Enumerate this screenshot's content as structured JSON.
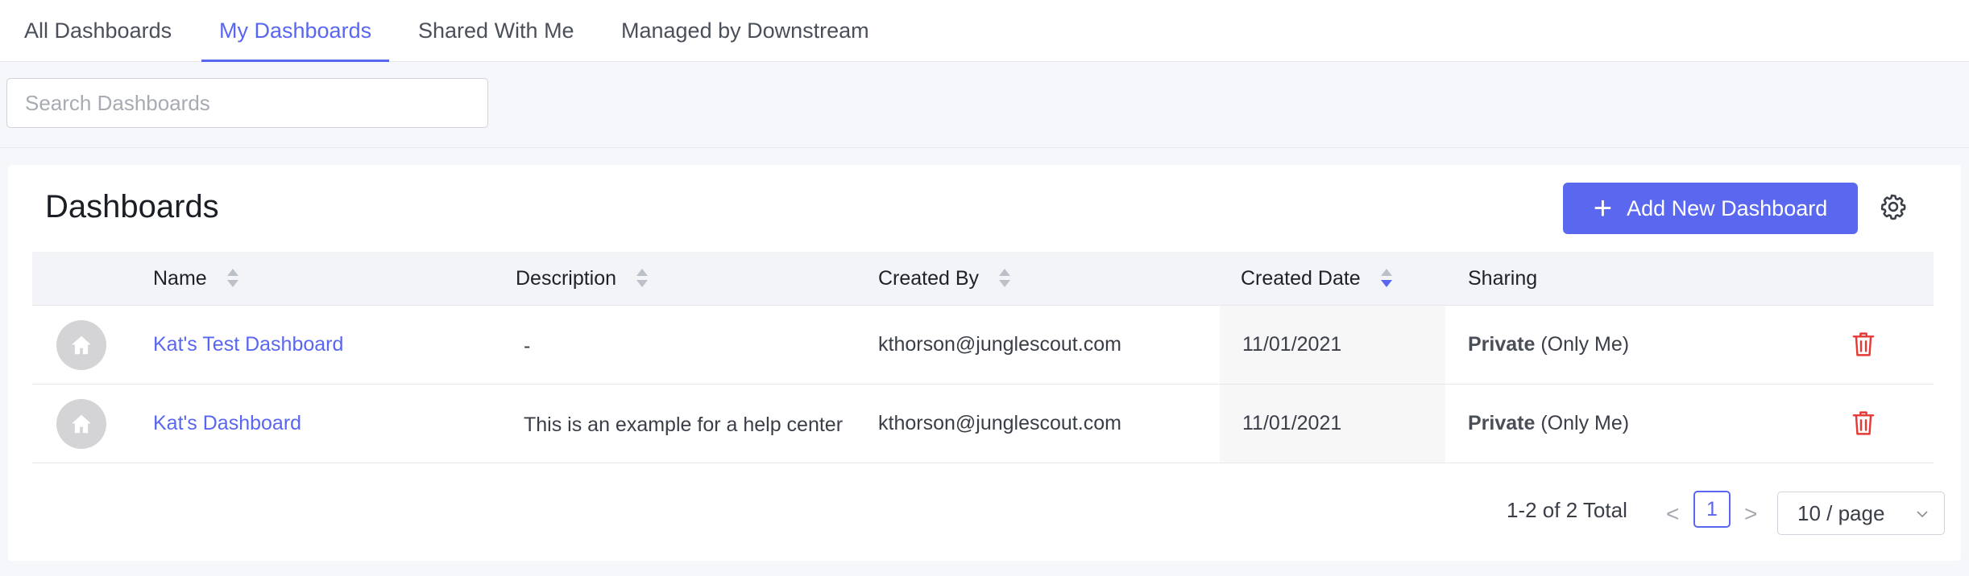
{
  "tabs": [
    {
      "label": "All Dashboards"
    },
    {
      "label": "My Dashboards"
    },
    {
      "label": "Shared With Me"
    },
    {
      "label": "Managed by Downstream"
    }
  ],
  "active_tab": "My Dashboards",
  "search": {
    "placeholder": "Search Dashboards",
    "value": ""
  },
  "card": {
    "title": "Dashboards",
    "add_button_label": "Add New Dashboard"
  },
  "table": {
    "columns": [
      "Name",
      "Description",
      "Created By",
      "Created Date",
      "Sharing"
    ],
    "sorted_column": "Created Date",
    "sort_direction": "descending",
    "rows": [
      {
        "name": "Kat's Test Dashboard",
        "description": "-",
        "created_by": "kthorson@junglescout.com",
        "created_date": "11/01/2021",
        "sharing_level": "Private",
        "sharing_detail": "(Only Me)"
      },
      {
        "name": "Kat's Dashboard",
        "description": "This is an example for a help center",
        "created_by": "kthorson@junglescout.com",
        "created_date": "11/01/2021",
        "sharing_level": "Private",
        "sharing_detail": "(Only Me)"
      }
    ]
  },
  "pagination": {
    "total_text": "1-2 of 2 Total",
    "prev": "<",
    "current_page": "1",
    "next": ">",
    "page_size": "10 / page"
  },
  "colors": {
    "accent": "#5966f0",
    "delete": "#e53935"
  },
  "icons": {
    "row_avatar": "home-icon",
    "settings": "gear-icon",
    "delete": "trash-icon",
    "add": "plus-icon",
    "page_size": "chevron-down-icon"
  }
}
